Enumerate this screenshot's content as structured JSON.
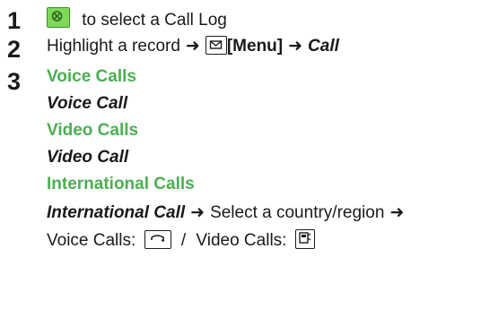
{
  "steps": [
    {
      "number": "1",
      "text": "to select a Call Log",
      "key_icon": "navigation-key-icon"
    },
    {
      "number": "2",
      "prefix": "Highlight a record",
      "menu_label": "[Menu]",
      "menu_key_icon": "mail-key-icon",
      "target": "Call"
    },
    {
      "number": "3",
      "voice_calls_heading": "Voice Calls",
      "voice_call_item": "Voice Call",
      "video_calls_heading": "Video Calls",
      "video_call_item": "Video Call",
      "international_heading": "International Calls",
      "international_item": "International Call",
      "select_country": "Select a country/region",
      "voice_label": "Voice Calls:",
      "voice_key_icon": "send-key-icon",
      "separator": "/",
      "video_label": "Video Calls:",
      "video_key_icon": "video-key-icon"
    }
  ],
  "colors": {
    "heading_green": "#4caf50",
    "text": "#1a1a1a",
    "nav_key_fill": "#7ed957"
  }
}
